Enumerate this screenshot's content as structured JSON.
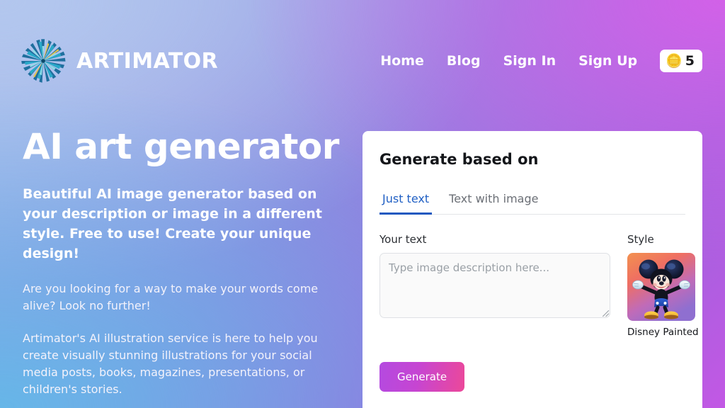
{
  "header": {
    "brand_name": "ARTIMATOR",
    "logo_icon": "starburst-logo-icon",
    "nav": [
      {
        "label": "Home"
      },
      {
        "label": "Blog"
      },
      {
        "label": "Sign In"
      },
      {
        "label": "Sign Up"
      }
    ],
    "credits": {
      "icon": "coins-icon",
      "icon_glyph": "🪙",
      "count": "5"
    }
  },
  "hero": {
    "title": "AI art generator",
    "lead": "Beautiful AI image generator based on your description or image in a different style. Free to use! Create your unique design!",
    "paragraph_1": "Are you looking for a way to make your words come alive? Look no further!",
    "paragraph_2": "Artimator's AI illustration service is here to help you create visually stunning illustrations for your social media posts, books, magazines, presentations, or children's stories."
  },
  "card": {
    "title": "Generate based on",
    "tabs": [
      {
        "label": "Just text",
        "active": true
      },
      {
        "label": "Text with image",
        "active": false
      }
    ],
    "text_field": {
      "label": "Your text",
      "placeholder": "Type image description here...",
      "value": ""
    },
    "style": {
      "label": "Style",
      "selected_name": "Disney Painted",
      "thumbnail": "disney-painted-thumbnail"
    },
    "generate_label": "Generate"
  },
  "colors": {
    "bg_top_left": "#b3c7ee",
    "bg_top_right": "#d261e8",
    "bg_bottom_left": "#66b6e8",
    "bg_bottom_right": "#9d63dd",
    "tab_active": "#2160c4",
    "tab_underline": "#1d58c0",
    "button_gradient_start": "#b44ae0",
    "button_gradient_end": "#ec4899",
    "card_bg": "#ffffff"
  }
}
